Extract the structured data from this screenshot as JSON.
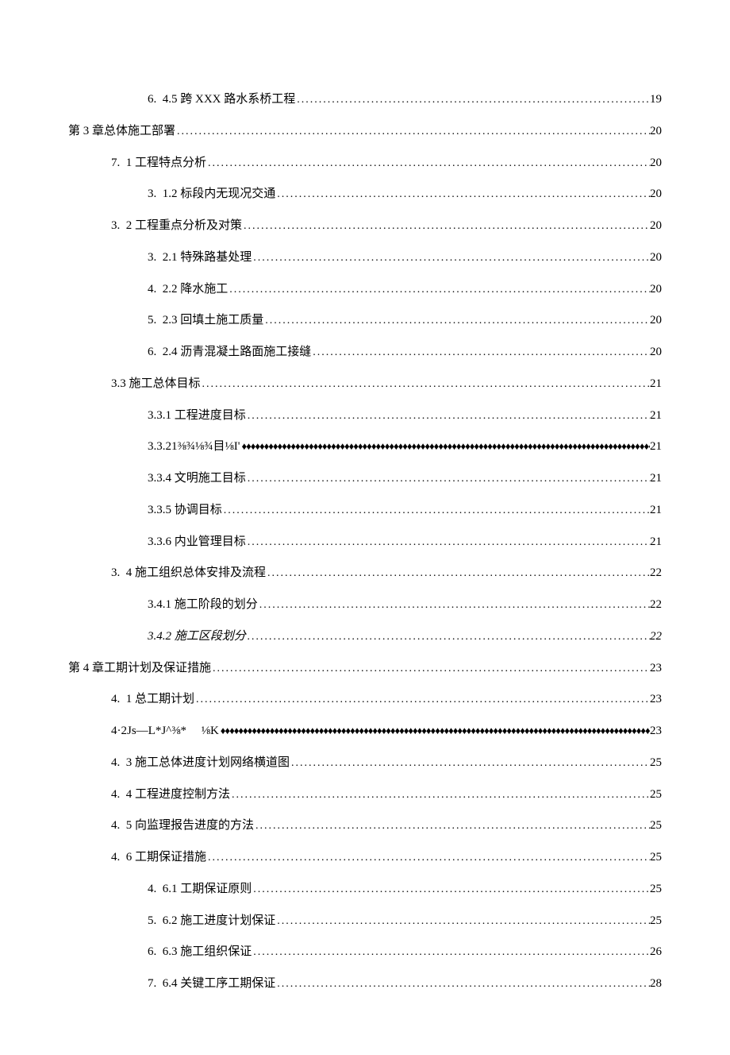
{
  "toc": [
    {
      "label": "6.  4.5 跨 XXX 路水系桥工程",
      "page": "19",
      "indent": 2,
      "leader": "dots"
    },
    {
      "label": "第 3 章总体施工部署",
      "page": "20",
      "indent": 0,
      "leader": "dots"
    },
    {
      "label": "7.  1 工程特点分析",
      "page": "20",
      "indent": 1,
      "leader": "dots"
    },
    {
      "label": "3.  1.2 标段内无现况交通",
      "page": "20",
      "indent": 2,
      "leader": "dots"
    },
    {
      "label": "3.  2 工程重点分析及对策",
      "page": "20",
      "indent": 1,
      "leader": "dots"
    },
    {
      "label": "3.  2.1 特殊路基处理",
      "page": "20",
      "indent": 2,
      "leader": "dots"
    },
    {
      "label": "4.  2.2 降水施工",
      "page": "20",
      "indent": 2,
      "leader": "dots"
    },
    {
      "label": "5.  2.3 回填土施工质量",
      "page": "20",
      "indent": 2,
      "leader": "dots"
    },
    {
      "label": "6.  2.4 沥青混凝土路面施工接缝",
      "page": "20",
      "indent": 2,
      "leader": "dots"
    },
    {
      "label": "3.3 施工总体目标",
      "page": "21",
      "indent": 1,
      "leader": "dots"
    },
    {
      "label": "3.3.1 工程进度目标",
      "page": "21",
      "indent": 2,
      "leader": "dots"
    },
    {
      "label": "3.3.21⅜¾⅛¾目⅛I'",
      "page": "21",
      "indent": 2,
      "leader": "diamond"
    },
    {
      "label": "3.3.4 文明施工目标",
      "page": "21",
      "indent": 2,
      "leader": "dots"
    },
    {
      "label": "3.3.5 协调目标",
      "page": "21",
      "indent": 2,
      "leader": "dots"
    },
    {
      "label": "3.3.6 内业管理目标",
      "page": "21",
      "indent": 2,
      "leader": "dots"
    },
    {
      "label": "3.  4 施工组织总体安排及流程",
      "page": "22",
      "indent": 1,
      "leader": "dots"
    },
    {
      "label": "3.4.1 施工阶段的划分",
      "page": "22",
      "indent": 2,
      "leader": "dots"
    },
    {
      "label": "3.4.2 施工区段划分",
      "page": "22",
      "indent": 2,
      "leader": "dots",
      "italic": true
    },
    {
      "label": "第 4 章工期计划及保证措施",
      "page": "23",
      "indent": 0,
      "leader": "dots"
    },
    {
      "label": "4.  1 总工期计划",
      "page": "23",
      "indent": 1,
      "leader": "dots"
    },
    {
      "label": "4·2Js—L*J^⅜*     ⅛K",
      "page": "23",
      "indent": 1,
      "leader": "diamond"
    },
    {
      "label": "4.  3 施工总体进度计划网络横道图",
      "page": "25",
      "indent": 1,
      "leader": "dots"
    },
    {
      "label": "4.  4 工程进度控制方法",
      "page": "25",
      "indent": 1,
      "leader": "dots"
    },
    {
      "label": "4.  5 向监理报告进度的方法",
      "page": "25",
      "indent": 1,
      "leader": "dots"
    },
    {
      "label": "4.  6 工期保证措施",
      "page": "25",
      "indent": 1,
      "leader": "dots"
    },
    {
      "label": "4.  6.1 工期保证原则",
      "page": "25",
      "indent": 2,
      "leader": "dots"
    },
    {
      "label": "5.  6.2 施工进度计划保证",
      "page": "25",
      "indent": 2,
      "leader": "dots"
    },
    {
      "label": "6.  6.3 施工组织保证",
      "page": "26",
      "indent": 2,
      "leader": "dots"
    },
    {
      "label": "7.  6.4 关键工序工期保证",
      "page": "28",
      "indent": 2,
      "leader": "dots"
    }
  ]
}
